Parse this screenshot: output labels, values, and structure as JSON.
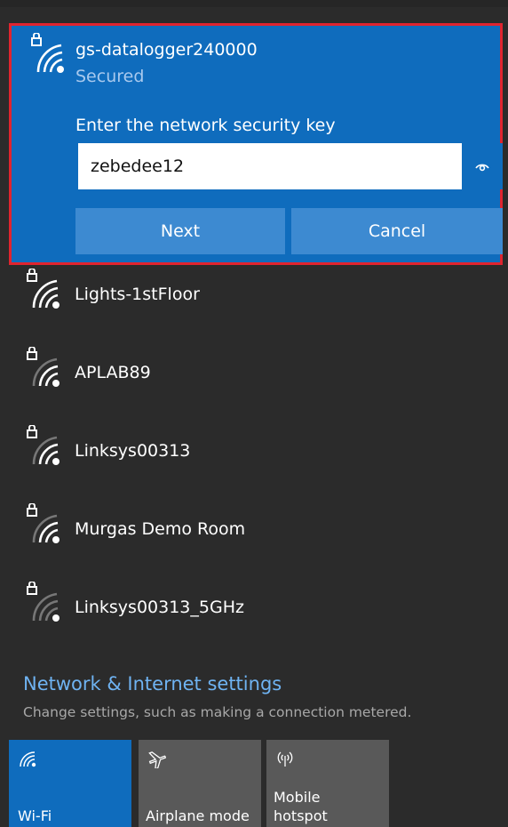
{
  "selected_network": {
    "ssid": "gs-datalogger240000",
    "status": "Secured",
    "prompt": "Enter the network security key",
    "key_value": "zebedee12",
    "icon": "secured-wifi-icon",
    "next_label": "Next",
    "cancel_label": "Cancel"
  },
  "networks": [
    {
      "name": "Lights-1stFloor",
      "icon": "secured-wifi-icon"
    },
    {
      "name": "APLAB89",
      "icon": "secured-wifi-icon"
    },
    {
      "name": "Linksys00313",
      "icon": "secured-wifi-icon"
    },
    {
      "name": "Murgas Demo Room",
      "icon": "secured-wifi-icon"
    },
    {
      "name": "Linksys00313_5GHz",
      "icon": "secured-wifi-weak-icon"
    }
  ],
  "settings": {
    "link": "Network & Internet settings",
    "description": "Change settings, such as making a connection metered."
  },
  "quick_actions": [
    {
      "label": "Wi-Fi",
      "icon": "wifi-icon",
      "active": true
    },
    {
      "label": "Airplane mode",
      "icon": "airplane-icon",
      "active": false
    },
    {
      "label_line1": "Mobile",
      "label_line2": "hotspot",
      "icon": "mobile-hotspot-icon",
      "active": false
    }
  ],
  "colors": {
    "accent": "#0f6cbd",
    "button": "#3d8ad1",
    "link": "#6fb3f2",
    "background": "#2b2b2b",
    "highlight_border": "#e0242f"
  }
}
